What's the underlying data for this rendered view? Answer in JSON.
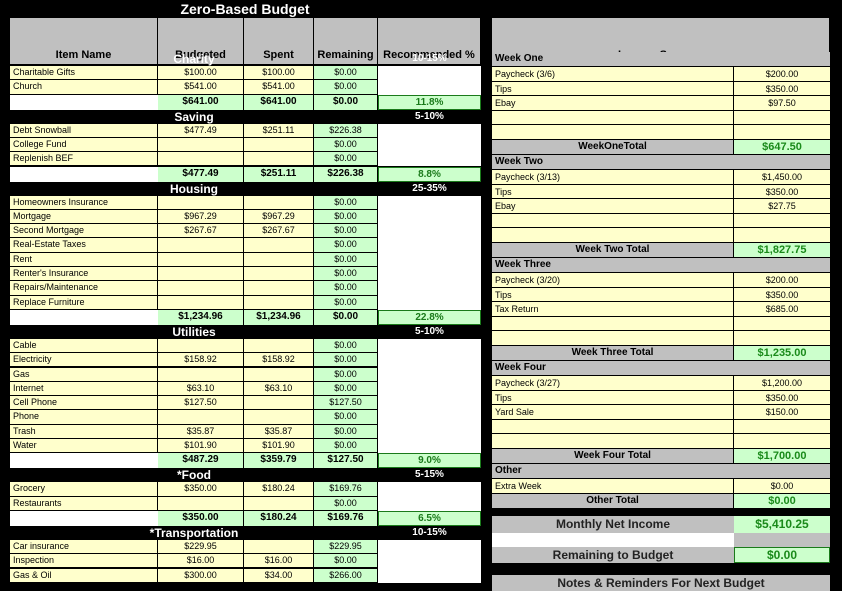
{
  "title": "Zero-Based Budget",
  "headers": {
    "item_name": "Item Name",
    "budgeted": "Budgeted",
    "spent": "Spent",
    "remaining": "Remaining",
    "recommended": "Recommended %",
    "income_sources": "Income Sources"
  },
  "categories": [
    {
      "name": "Charity",
      "recommended": "10-15%",
      "items": [
        {
          "name": "Charitable Gifts",
          "budgeted": "$100.00",
          "spent": "$100.00",
          "remaining": "$0.00"
        },
        {
          "name": "Church",
          "budgeted": "$541.00",
          "spent": "$541.00",
          "remaining": "$0.00"
        }
      ],
      "total": {
        "budgeted": "$641.00",
        "spent": "$641.00",
        "remaining": "$0.00",
        "percent": "11.8%"
      }
    },
    {
      "name": "Saving",
      "recommended": "5-10%",
      "items": [
        {
          "name": "Debt Snowball",
          "budgeted": "$477.49",
          "spent": "$251.11",
          "remaining": "$226.38"
        },
        {
          "name": "College Fund",
          "budgeted": "",
          "spent": "",
          "remaining": "$0.00"
        },
        {
          "name": "Replenish BEF",
          "budgeted": "",
          "spent": "",
          "remaining": "$0.00"
        }
      ],
      "total": {
        "budgeted": "$477.49",
        "spent": "$251.11",
        "remaining": "$226.38",
        "percent": "8.8%"
      }
    },
    {
      "name": "Housing",
      "recommended": "25-35%",
      "items": [
        {
          "name": "Homeowners Insurance",
          "budgeted": "",
          "spent": "",
          "remaining": "$0.00"
        },
        {
          "name": "Mortgage",
          "budgeted": "$967.29",
          "spent": "$967.29",
          "remaining": "$0.00"
        },
        {
          "name": "Second Mortgage",
          "budgeted": "$267.67",
          "spent": "$267.67",
          "remaining": "$0.00"
        },
        {
          "name": "Real-Estate Taxes",
          "budgeted": "",
          "spent": "",
          "remaining": "$0.00"
        },
        {
          "name": "Rent",
          "budgeted": "",
          "spent": "",
          "remaining": "$0.00"
        },
        {
          "name": "Renter's Insurance",
          "budgeted": "",
          "spent": "",
          "remaining": "$0.00"
        },
        {
          "name": "Repairs/Maintenance",
          "budgeted": "",
          "spent": "",
          "remaining": "$0.00"
        },
        {
          "name": "Replace Furniture",
          "budgeted": "",
          "spent": "",
          "remaining": "$0.00"
        }
      ],
      "total": {
        "budgeted": "$1,234.96",
        "spent": "$1,234.96",
        "remaining": "$0.00",
        "percent": "22.8%"
      }
    },
    {
      "name": "Utilities",
      "recommended": "5-10%",
      "items": [
        {
          "name": "Cable",
          "budgeted": "",
          "spent": "",
          "remaining": "$0.00"
        },
        {
          "name": "Electricity",
          "budgeted": "$158.92",
          "spent": "$158.92",
          "remaining": "$0.00"
        },
        {
          "name": "Gas",
          "budgeted": "",
          "spent": "",
          "remaining": "$0.00"
        },
        {
          "name": "Internet",
          "budgeted": "$63.10",
          "spent": "$63.10",
          "remaining": "$0.00"
        },
        {
          "name": "Cell Phone",
          "budgeted": "$127.50",
          "spent": "",
          "remaining": "$127.50"
        },
        {
          "name": "Phone",
          "budgeted": "",
          "spent": "",
          "remaining": "$0.00"
        },
        {
          "name": "Trash",
          "budgeted": "$35.87",
          "spent": "$35.87",
          "remaining": "$0.00"
        },
        {
          "name": "Water",
          "budgeted": "$101.90",
          "spent": "$101.90",
          "remaining": "$0.00"
        }
      ],
      "total": {
        "budgeted": "$487.29",
        "spent": "$359.79",
        "remaining": "$127.50",
        "percent": "9.0%"
      }
    },
    {
      "name": "*Food",
      "recommended": "5-15%",
      "items": [
        {
          "name": "Grocery",
          "budgeted": "$350.00",
          "spent": "$180.24",
          "remaining": "$169.76"
        },
        {
          "name": "Restaurants",
          "budgeted": "",
          "spent": "",
          "remaining": "$0.00"
        }
      ],
      "total": {
        "budgeted": "$350.00",
        "spent": "$180.24",
        "remaining": "$169.76",
        "percent": "6.5%"
      }
    },
    {
      "name": "*Transportation",
      "recommended": "10-15%",
      "items": [
        {
          "name": "Car insurance",
          "budgeted": "$229.95",
          "spent": "",
          "remaining": "$229.95"
        },
        {
          "name": "Inspection",
          "budgeted": "$16.00",
          "spent": "$16.00",
          "remaining": "$0.00"
        },
        {
          "name": "Gas & Oil",
          "budgeted": "$300.00",
          "spent": "$34.00",
          "remaining": "$266.00"
        }
      ]
    }
  ],
  "income": {
    "weeks": [
      {
        "label": "Week One",
        "items": [
          {
            "name": "Paycheck (3/6)",
            "value": "$200.00"
          },
          {
            "name": "Tips",
            "value": "$350.00"
          },
          {
            "name": "Ebay",
            "value": "$97.50"
          },
          {
            "name": "",
            "value": ""
          },
          {
            "name": "",
            "value": ""
          }
        ],
        "total_label": "WeekOneTotal",
        "total": "$647.50"
      },
      {
        "label": "Week Two",
        "items": [
          {
            "name": "Paycheck (3/13)",
            "value": "$1,450.00"
          },
          {
            "name": "Tips",
            "value": "$350.00"
          },
          {
            "name": "Ebay",
            "value": "$27.75"
          },
          {
            "name": "",
            "value": ""
          },
          {
            "name": "",
            "value": ""
          }
        ],
        "total_label": "Week Two Total",
        "total": "$1,827.75"
      },
      {
        "label": "Week Three",
        "items": [
          {
            "name": "Paycheck (3/20)",
            "value": "$200.00"
          },
          {
            "name": "Tips",
            "value": "$350.00"
          },
          {
            "name": "Tax Return",
            "value": "$685.00"
          },
          {
            "name": "",
            "value": ""
          },
          {
            "name": "",
            "value": ""
          }
        ],
        "total_label": "Week Three Total",
        "total": "$1,235.00"
      },
      {
        "label": "Week Four",
        "items": [
          {
            "name": "Paycheck (3/27)",
            "value": "$1,200.00"
          },
          {
            "name": "Tips",
            "value": "$350.00"
          },
          {
            "name": "Yard Sale",
            "value": "$150.00"
          },
          {
            "name": "",
            "value": ""
          },
          {
            "name": "",
            "value": ""
          }
        ],
        "total_label": "Week Four Total",
        "total": "$1,700.00"
      },
      {
        "label": "Other",
        "items": [
          {
            "name": "Extra Week",
            "value": "$0.00"
          }
        ],
        "total_label": "Other Total",
        "total": "$0.00"
      }
    ],
    "monthly_net_income_label": "Monthly Net Income",
    "monthly_net_income": "$5,410.25",
    "remaining_label": "Remaining to Budget",
    "remaining": "$0.00",
    "notes_label": "Notes & Reminders For Next Budget"
  }
}
